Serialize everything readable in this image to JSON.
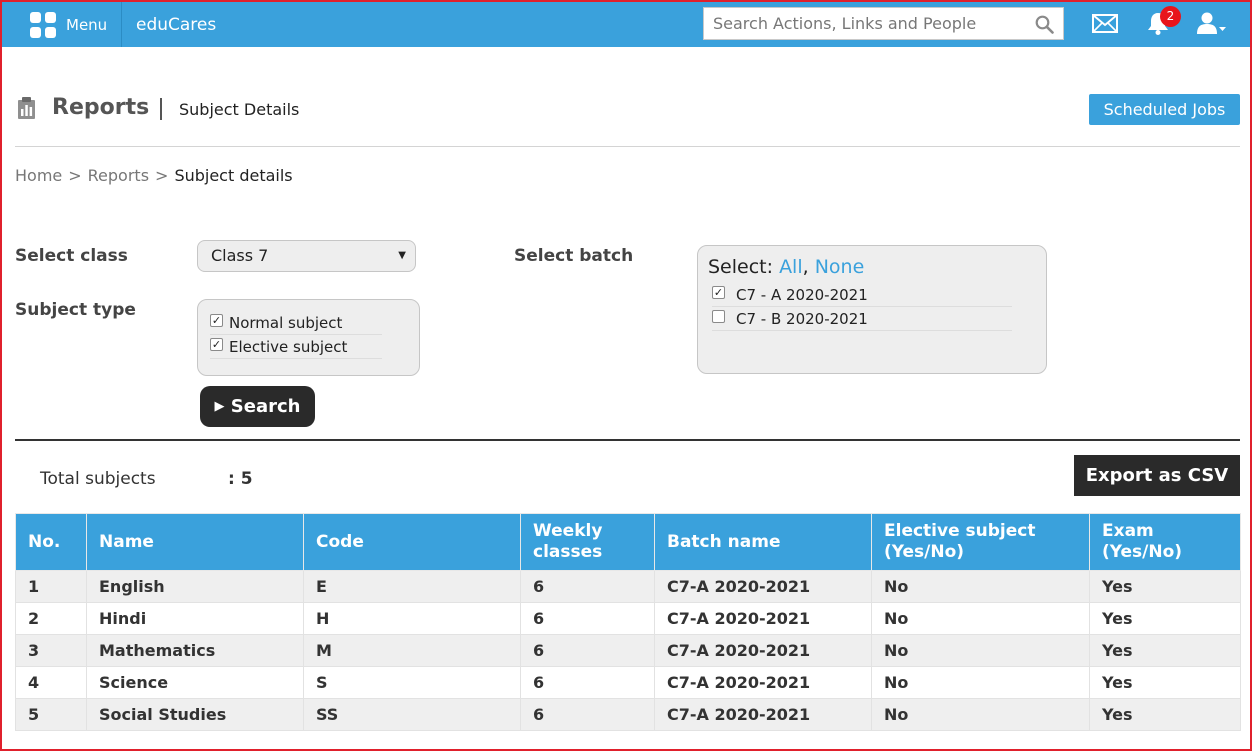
{
  "topbar": {
    "menu_label": "Menu",
    "app_name": "eduCares",
    "search_placeholder": "Search Actions, Links and People",
    "notification_count": "2"
  },
  "header": {
    "title": "Reports",
    "subtitle": "Subject Details",
    "scheduled_jobs_label": "Scheduled Jobs"
  },
  "breadcrumb": {
    "home": "Home",
    "reports": "Reports",
    "current": "Subject details",
    "separator": ">"
  },
  "form": {
    "select_class_label": "Select class",
    "selected_class": "Class 7",
    "subject_type_label": "Subject type",
    "subject_types": [
      {
        "label": "Normal subject",
        "checked": true
      },
      {
        "label": "Elective subject",
        "checked": true
      }
    ],
    "select_batch_label": "Select batch",
    "batch_select_prefix": "Select:",
    "batch_select_all": "All",
    "batch_select_comma": ",",
    "batch_select_none": "None",
    "batches": [
      {
        "label": "C7 - A 2020-2021",
        "checked": true
      },
      {
        "label": "C7 - B 2020-2021",
        "checked": false
      }
    ],
    "search_label": "Search"
  },
  "summary": {
    "total_label": "Total subjects",
    "total_value": ": 5",
    "export_label": "Export as CSV"
  },
  "table": {
    "headers": {
      "no": "No.",
      "name": "Name",
      "code": "Code",
      "weekly_line1": "Weekly",
      "weekly_line2": "classes",
      "batch": "Batch name",
      "elective_line1": "Elective subject",
      "elective_line2": "(Yes/No)",
      "exam_line1": "Exam",
      "exam_line2": "(Yes/No)"
    },
    "rows": [
      {
        "no": "1",
        "name": "English",
        "code": "E",
        "weekly": "6",
        "batch": "C7-A 2020-2021",
        "elective": "No",
        "exam": "Yes"
      },
      {
        "no": "2",
        "name": "Hindi",
        "code": "H",
        "weekly": "6",
        "batch": "C7-A 2020-2021",
        "elective": "No",
        "exam": "Yes"
      },
      {
        "no": "3",
        "name": "Mathematics",
        "code": "M",
        "weekly": "6",
        "batch": "C7-A 2020-2021",
        "elective": "No",
        "exam": "Yes"
      },
      {
        "no": "4",
        "name": "Science",
        "code": "S",
        "weekly": "6",
        "batch": "C7-A 2020-2021",
        "elective": "No",
        "exam": "Yes"
      },
      {
        "no": "5",
        "name": "Social Studies",
        "code": "SS",
        "weekly": "6",
        "batch": "C7-A 2020-2021",
        "elective": "No",
        "exam": "Yes"
      }
    ]
  },
  "colors": {
    "accent": "#3aa1dc",
    "dark_button": "#2a2a2a",
    "badge": "#e8141b",
    "frame": "#e0202c"
  },
  "icons": [
    "apps-grid-icon",
    "search-icon",
    "mail-icon",
    "bell-icon",
    "user-icon",
    "reports-icon",
    "play-icon",
    "chevron-down-icon",
    "checkbox-icon"
  ]
}
